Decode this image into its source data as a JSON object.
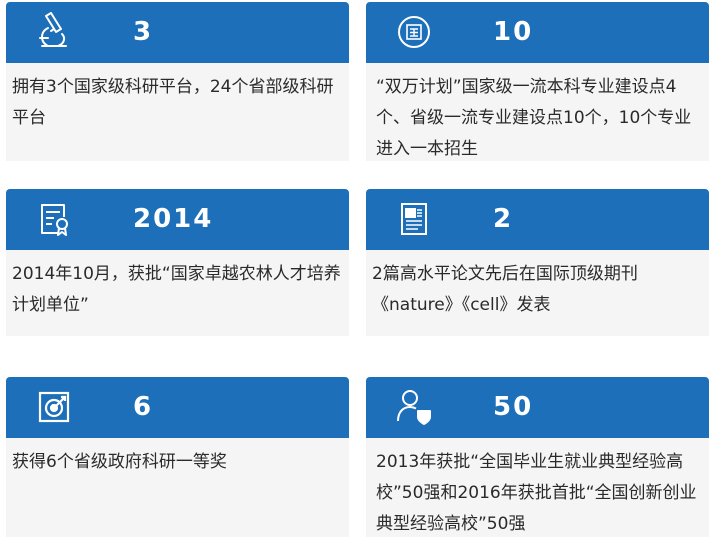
{
  "cards": [
    {
      "icon": "microscope-icon",
      "number": "3",
      "text": "拥有3个国家级科研平台，24个省部级科研平台"
    },
    {
      "icon": "national-seal-icon",
      "number": "10",
      "text": "“双万计划”国家级一流本科专业建设点4个、省级一流专业建设点10个，10个专业进入一本招生"
    },
    {
      "icon": "certificate-icon",
      "number": "2014",
      "text": "2014年10月，获批“国家卓越农林人才培养计划单位”"
    },
    {
      "icon": "paper-document-icon",
      "number": "2",
      "text": "2篇高水平论文先后在国际顶级期刊《nature》《cell》发表"
    },
    {
      "icon": "target-award-icon",
      "number": "6",
      "text": "获得6个省级政府科研一等奖"
    },
    {
      "icon": "person-shield-icon",
      "number": "50",
      "text": "2013年获批“全国毕业生就业典型经验高校”50强和2016年获批首批“全国创新创业典型经验高校”50强"
    }
  ],
  "colors": {
    "header": "#1c6fb8",
    "body_bg": "#f5f5f6",
    "text": "#2a2a2a"
  }
}
